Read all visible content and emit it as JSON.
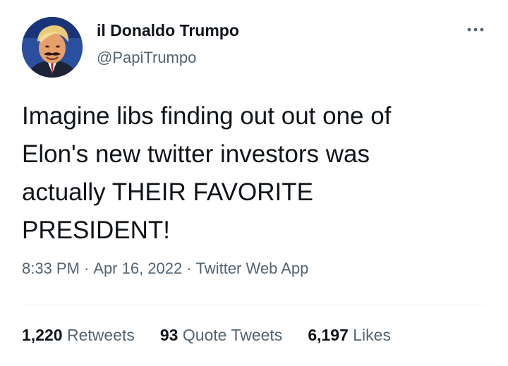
{
  "tweet": {
    "author": {
      "display_name": "il Donaldo Trumpo",
      "handle": "@PapiTrumpo",
      "avatar_icon": "profile-photo"
    },
    "more_icon": "more-options-icon",
    "text": "Imagine libs finding out out one of\nElon's new twitter investors was\nactually THEIR FAVORITE\nPRESIDENT!",
    "meta": {
      "time": "8:33 PM",
      "separator": "·",
      "date": "Apr 16, 2022",
      "source": "Twitter Web App"
    },
    "stats": {
      "retweets_count": "1,220",
      "retweets_label": "Retweets",
      "quote_tweets_count": "93",
      "quote_tweets_label": "Quote Tweets",
      "likes_count": "6,197",
      "likes_label": "Likes"
    }
  },
  "colors": {
    "text_primary": "#0f1419",
    "text_secondary": "#536471",
    "divider": "#eff3f4"
  }
}
